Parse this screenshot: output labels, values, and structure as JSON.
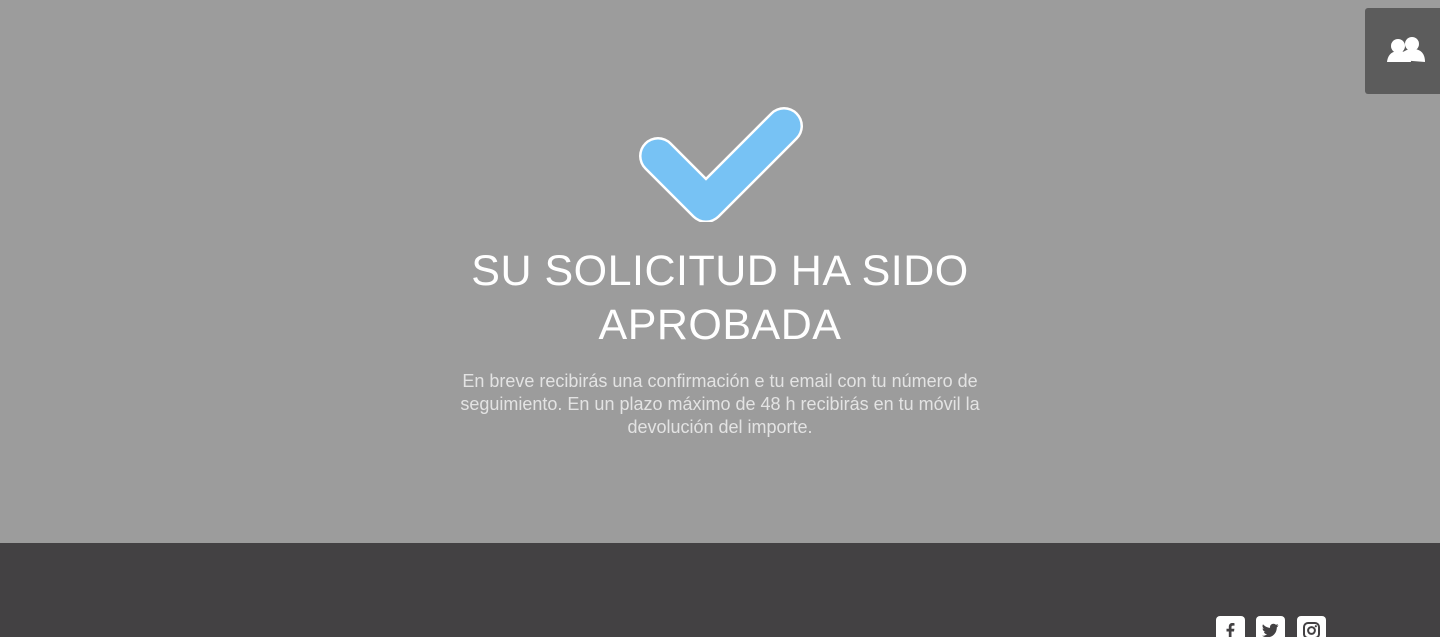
{
  "hero": {
    "status_icon": "checkmark-icon",
    "title": "SU SOLICITUD HA SIDO APROBADA",
    "message": "En breve recibirás una confirmación e tu email con tu número de seguimiento. En un plazo máximo de 48 h recibirás en tu móvil la devolución del importe."
  },
  "top_right": {
    "icon": "users-icon"
  },
  "footer": {
    "social": [
      {
        "name": "facebook-icon"
      },
      {
        "name": "twitter-icon"
      },
      {
        "name": "instagram-icon"
      }
    ]
  },
  "colors": {
    "background": "#9c9c9c",
    "accent": "#77c2f4",
    "footer": "#434143",
    "button": "#5c5c5c"
  }
}
